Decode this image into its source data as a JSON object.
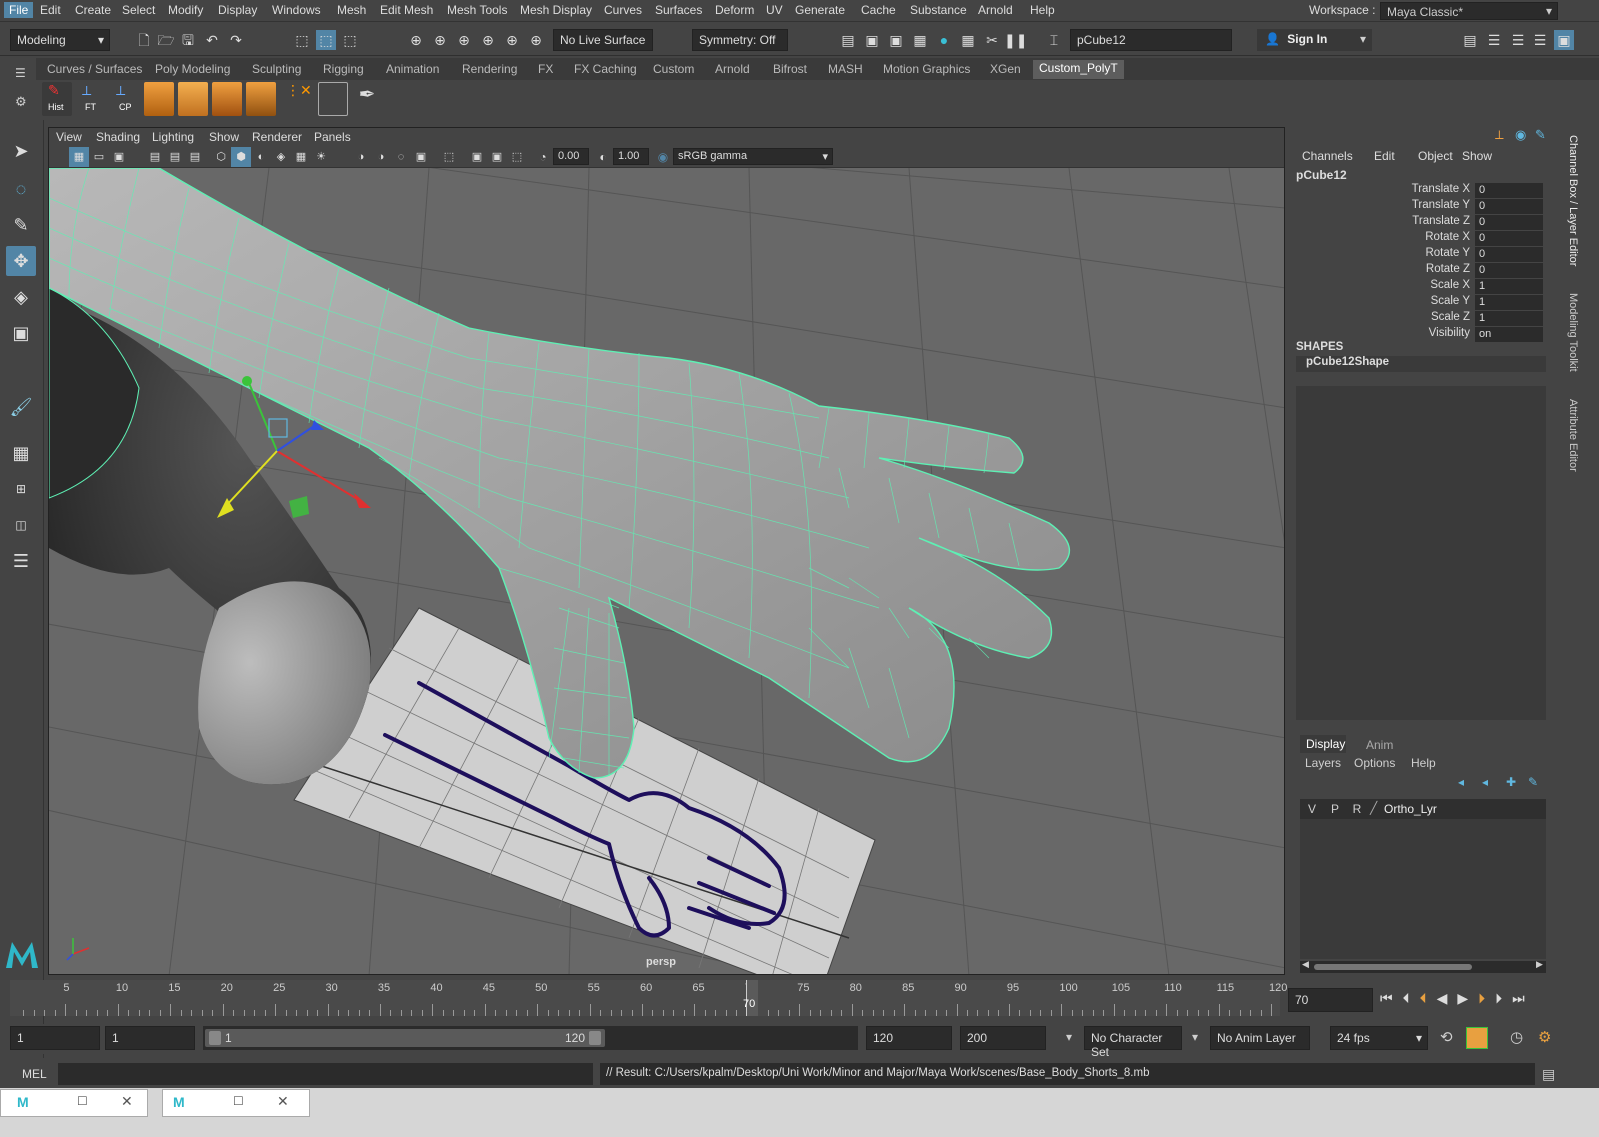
{
  "menubar": {
    "items": [
      "File",
      "Edit",
      "Create",
      "Select",
      "Modify",
      "Display",
      "Windows",
      "Mesh",
      "Edit Mesh",
      "Mesh Tools",
      "Mesh Display",
      "Curves",
      "Surfaces",
      "Deform",
      "UV",
      "Generate",
      "Cache",
      "Substance",
      "Arnold",
      "Help"
    ],
    "workspace_label": "Workspace :",
    "workspace_value": "Maya Classic*"
  },
  "statusline": {
    "mode": "Modeling",
    "live_surface": "No Live Surface",
    "symmetry": "Symmetry: Off",
    "object_name": "pCube12",
    "sign_in": "Sign In"
  },
  "shelf": {
    "tabs": [
      "Curves / Surfaces",
      "Poly Modeling",
      "Sculpting",
      "Rigging",
      "Animation",
      "Rendering",
      "FX",
      "FX Caching",
      "Custom",
      "Arnold",
      "Bifrost",
      "MASH",
      "Motion Graphics",
      "XGen",
      "Custom_PolyT"
    ],
    "active_tab": "Custom_PolyT",
    "buttons": [
      "Hist",
      "FT",
      "CP"
    ]
  },
  "viewport": {
    "menu": [
      "View",
      "Shading",
      "Lighting",
      "Show",
      "Renderer",
      "Panels"
    ],
    "exposure": "0.00",
    "gamma": "1.00",
    "color_space": "sRGB gamma",
    "camera_label": "persp"
  },
  "channel_box": {
    "menu": [
      "Channels",
      "Edit",
      "Object",
      "Show"
    ],
    "object": "pCube12",
    "attributes": [
      {
        "name": "Translate X",
        "value": "0"
      },
      {
        "name": "Translate Y",
        "value": "0"
      },
      {
        "name": "Translate Z",
        "value": "0"
      },
      {
        "name": "Rotate X",
        "value": "0"
      },
      {
        "name": "Rotate Y",
        "value": "0"
      },
      {
        "name": "Rotate Z",
        "value": "0"
      },
      {
        "name": "Scale X",
        "value": "1"
      },
      {
        "name": "Scale Y",
        "value": "1"
      },
      {
        "name": "Scale Z",
        "value": "1"
      },
      {
        "name": "Visibility",
        "value": "on"
      }
    ],
    "shapes_header": "SHAPES",
    "shape_name": "pCube12Shape"
  },
  "layer_editor": {
    "tabs": [
      "Display",
      "Anim"
    ],
    "menu": [
      "Layers",
      "Options",
      "Help"
    ],
    "layer": {
      "v": "V",
      "p": "P",
      "r": "R",
      "name": "Ortho_Lyr"
    }
  },
  "side_tabs": [
    "Channel Box / Layer Editor",
    "Modeling Toolkit",
    "Attribute Editor"
  ],
  "timeline": {
    "ticks": [
      "5",
      "10",
      "15",
      "20",
      "25",
      "30",
      "35",
      "40",
      "45",
      "50",
      "55",
      "60",
      "65",
      "70",
      "75",
      "80",
      "85",
      "90",
      "95",
      "100",
      "105",
      "110",
      "115",
      "120"
    ],
    "current_frame": "70",
    "frame_field": "70"
  },
  "range": {
    "start": "1",
    "playback_start": "1",
    "slider_start": "1",
    "slider_end": "120",
    "playback_end": "120",
    "end": "200",
    "character_set": "No Character Set",
    "anim_layer": "No Anim Layer",
    "fps": "24 fps"
  },
  "command_line": {
    "label": "MEL",
    "result": "// Result: C:/Users/kpalm/Desktop/Uni Work/Minor and Major/Maya Work/scenes/Base_Body_Shorts_8.mb"
  },
  "colors": {
    "accent": "#5285a6",
    "wire": "#5ef0b4",
    "curve": "#1e0f5c"
  }
}
